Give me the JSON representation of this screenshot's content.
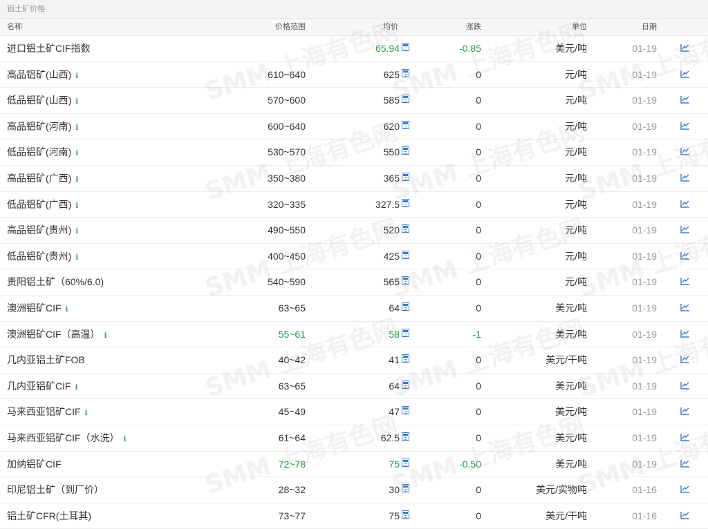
{
  "title": "铝土矿价格",
  "headers": {
    "name": "名称",
    "range": "价格范围",
    "avg": "均价",
    "change": "涨跌",
    "unit": "单位",
    "date": "日期"
  },
  "watermark_text": "SMM 上海有色网",
  "rows": [
    {
      "name": "进口铝土矿CIF指数",
      "info": false,
      "range": "",
      "avg": "65.94",
      "change": "-0.85",
      "unit": "美元/吨",
      "date": "01-19",
      "green_range": false,
      "green_avg": true,
      "green_change": true
    },
    {
      "name": "高品铝矿(山西)",
      "info": true,
      "range": "610~640",
      "avg": "625",
      "change": "0",
      "unit": "元/吨",
      "date": "01-19"
    },
    {
      "name": "低品铝矿(山西)",
      "info": true,
      "range": "570~600",
      "avg": "585",
      "change": "0",
      "unit": "元/吨",
      "date": "01-19"
    },
    {
      "name": "高品铝矿(河南)",
      "info": true,
      "range": "600~640",
      "avg": "620",
      "change": "0",
      "unit": "元/吨",
      "date": "01-19"
    },
    {
      "name": "低品铝矿(河南)",
      "info": true,
      "range": "530~570",
      "avg": "550",
      "change": "0",
      "unit": "元/吨",
      "date": "01-19"
    },
    {
      "name": "高品铝矿(广西)",
      "info": true,
      "range": "350~380",
      "avg": "365",
      "change": "0",
      "unit": "元/吨",
      "date": "01-19"
    },
    {
      "name": "低品铝矿(广西)",
      "info": true,
      "range": "320~335",
      "avg": "327.5",
      "change": "0",
      "unit": "元/吨",
      "date": "01-19"
    },
    {
      "name": "高品铝矿(贵州)",
      "info": true,
      "range": "490~550",
      "avg": "520",
      "change": "0",
      "unit": "元/吨",
      "date": "01-19"
    },
    {
      "name": "低品铝矿(贵州)",
      "info": true,
      "range": "400~450",
      "avg": "425",
      "change": "0",
      "unit": "元/吨",
      "date": "01-19"
    },
    {
      "name": "贵阳铝土矿（60%/6.0)",
      "info": false,
      "range": "540~590",
      "avg": "565",
      "change": "0",
      "unit": "元/吨",
      "date": "01-19"
    },
    {
      "name": "澳洲铝矿CIF",
      "info": true,
      "range": "63~65",
      "avg": "64",
      "change": "0",
      "unit": "美元/吨",
      "date": "01-19"
    },
    {
      "name": "澳洲铝矿CIF（高温）",
      "info": true,
      "range": "55~61",
      "avg": "58",
      "change": "-1",
      "unit": "美元/吨",
      "date": "01-19",
      "green_range": true,
      "green_avg": true,
      "green_change": true
    },
    {
      "name": "几内亚铝土矿FOB",
      "info": false,
      "range": "40~42",
      "avg": "41",
      "change": "0",
      "unit": "美元/干吨",
      "date": "01-19"
    },
    {
      "name": "几内亚铝矿CIF",
      "info": true,
      "range": "63~65",
      "avg": "64",
      "change": "0",
      "unit": "美元/吨",
      "date": "01-19"
    },
    {
      "name": "马来西亚铝矿CIF",
      "info": true,
      "range": "45~49",
      "avg": "47",
      "change": "0",
      "unit": "美元/吨",
      "date": "01-19"
    },
    {
      "name": "马来西亚铝矿CIF（水洗）",
      "info": true,
      "range": "61~64",
      "avg": "62.5",
      "change": "0",
      "unit": "美元/吨",
      "date": "01-19"
    },
    {
      "name": "加纳铝矿CIF",
      "info": false,
      "range": "72~78",
      "avg": "75",
      "change": "-0.50",
      "unit": "美元/吨",
      "date": "01-19",
      "green_range": true,
      "green_avg": true,
      "green_change": true
    },
    {
      "name": "印尼铝土矿（到厂价）",
      "info": false,
      "range": "28~32",
      "avg": "30",
      "change": "0",
      "unit": "美元/实物吨",
      "date": "01-16"
    },
    {
      "name": "铝土矿CFR(土耳其)",
      "info": false,
      "range": "73~77",
      "avg": "75",
      "change": "0",
      "unit": "美元/干吨",
      "date": "01-16"
    }
  ]
}
